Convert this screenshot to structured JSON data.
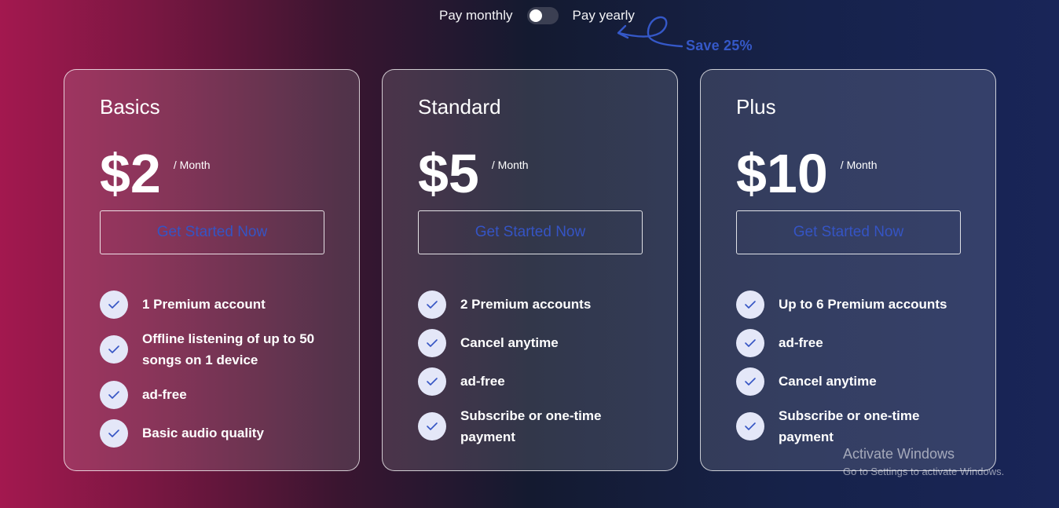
{
  "billing_toggle": {
    "monthly_label": "Pay monthly",
    "yearly_label": "Pay yearly",
    "state": "monthly",
    "save_text": "Save 25%"
  },
  "plans": [
    {
      "name": "Basics",
      "price": "$2",
      "period": "/ Month",
      "cta": "Get Started Now",
      "features": [
        "1 Premium account",
        "Offline listening of up to 50 songs on 1 device",
        "ad-free",
        "Basic audio quality"
      ]
    },
    {
      "name": "Standard",
      "price": "$5",
      "period": "/ Month",
      "cta": "Get Started Now",
      "features": [
        "2 Premium accounts",
        "Cancel anytime",
        "ad-free",
        "Subscribe or one-time payment"
      ]
    },
    {
      "name": "Plus",
      "price": "$10",
      "period": "/ Month",
      "cta": "Get Started Now",
      "features": [
        "Up to 6 Premium accounts",
        "ad-free",
        "Cancel anytime",
        "Subscribe or one-time payment"
      ]
    }
  ],
  "watermark": {
    "title": "Activate Windows",
    "subtitle": "Go to Settings to activate Windows."
  },
  "colors": {
    "accent": "#3558c8",
    "check_bg": "#e4e7f8",
    "check_mark": "#3554c4"
  },
  "icons": {
    "feature": "check-icon",
    "annotation": "curly-arrow-icon"
  }
}
